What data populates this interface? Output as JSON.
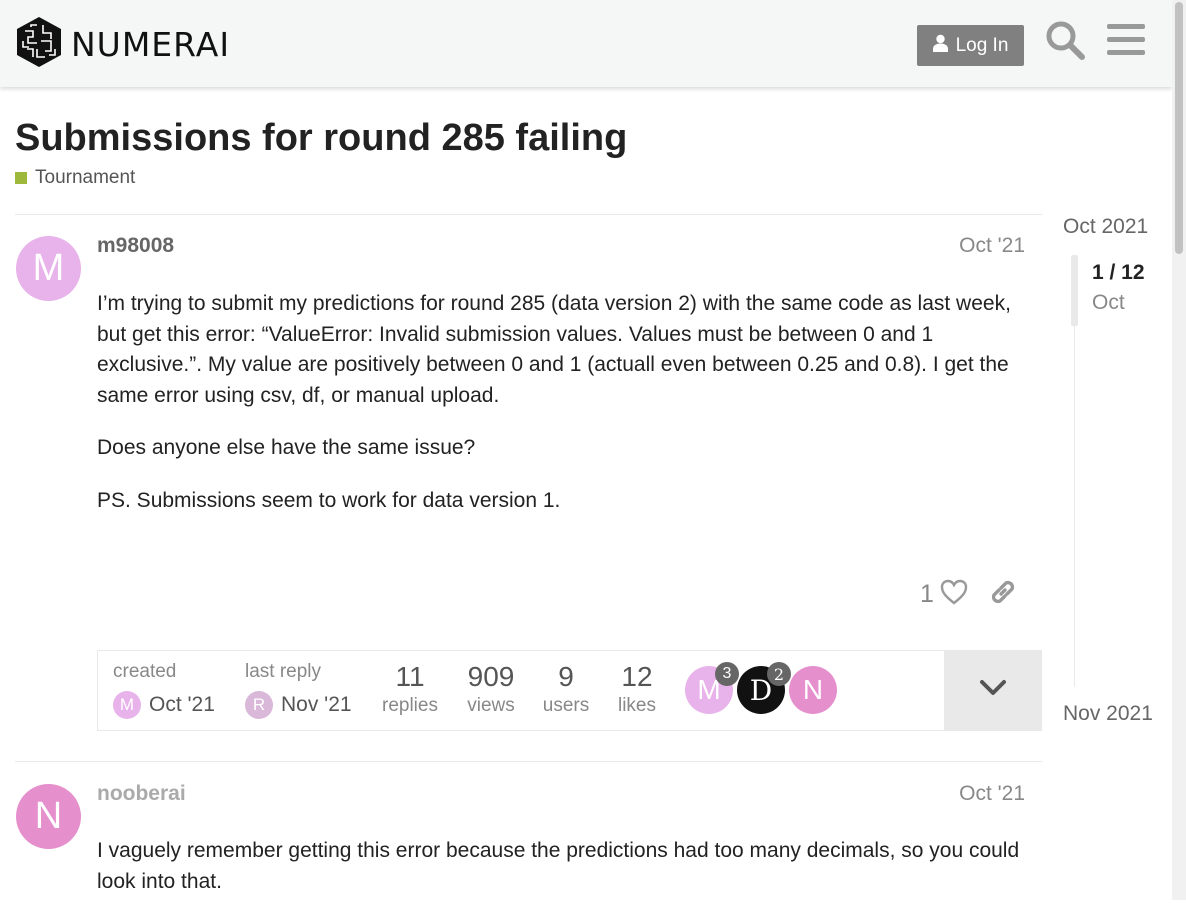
{
  "header": {
    "logo_text": "NUMERAI",
    "login_label": "Log In",
    "icons": [
      "numerai-logo-icon",
      "user-icon",
      "search-icon",
      "hamburger-menu-icon"
    ]
  },
  "topic": {
    "title": "Submissions for round 285 failing",
    "category": "Tournament",
    "category_color": "#9eb83b"
  },
  "posts": [
    {
      "username": "m98008",
      "avatar_letter": "M",
      "avatar_color": "#e8b3ea",
      "date": "Oct '21",
      "paragraphs": [
        "I’m trying to submit my predictions for round 285 (data version 2) with the same code as last week, but get this error: “ValueError: Invalid submission values. Values must be between 0 and 1 exclusive.”. My value are positively between 0 and 1 (actuall even between 0.25 and 0.8). I get the same error using csv, df, or manual upload.",
        "Does anyone else have the same issue?",
        "PS. Submissions seem to work for data version 1."
      ],
      "likes": "1"
    },
    {
      "username": "nooberai",
      "avatar_letter": "N",
      "avatar_color": "#e68fcd",
      "date": "Oct '21",
      "paragraphs": [
        "I vaguely remember getting this error because the predictions had too many decimals, so you could look into that."
      ]
    }
  ],
  "topic_map": {
    "created_label": "created",
    "created_date": "Oct '21",
    "created_avatar": "M",
    "last_reply_label": "last reply",
    "last_reply_date": "Nov '21",
    "last_reply_avatar": "R",
    "stats": [
      {
        "num": "11",
        "label": "replies"
      },
      {
        "num": "909",
        "label": "views"
      },
      {
        "num": "9",
        "label": "users"
      },
      {
        "num": "12",
        "label": "likes"
      }
    ],
    "participants": [
      {
        "letter": "M",
        "count": "3",
        "color": "#e8b3ea"
      },
      {
        "letter": "D",
        "count": "2",
        "color": "#111111"
      },
      {
        "letter": "N",
        "count": "",
        "color": "#e68fcd"
      }
    ]
  },
  "timeline": {
    "start_label": "Oct 2021",
    "position": "1 / 12",
    "current_date": "Oct",
    "end_label": "Nov 2021"
  }
}
